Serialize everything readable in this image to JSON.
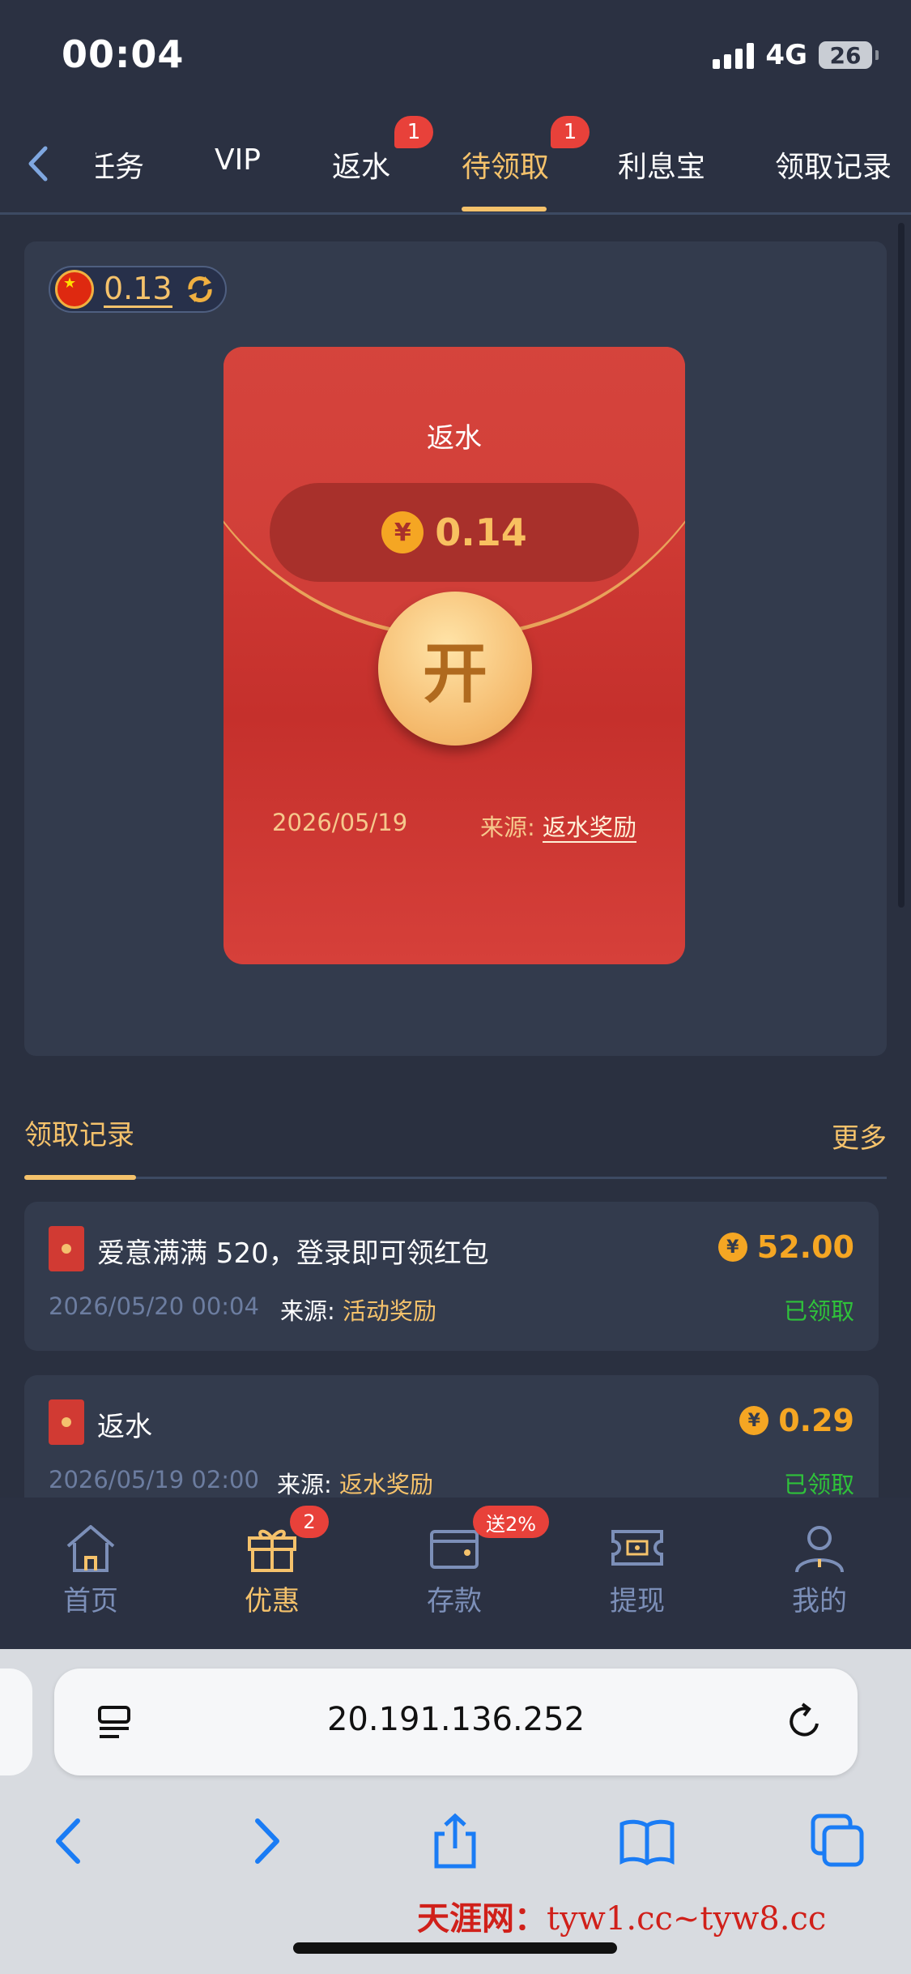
{
  "status": {
    "time": "00:04",
    "network": "4G",
    "battery": "26"
  },
  "tabs": [
    {
      "label": "任务",
      "badge": ""
    },
    {
      "label": "VIP",
      "badge": ""
    },
    {
      "label": "返水",
      "badge": "1"
    },
    {
      "label": "待领取",
      "badge": "1",
      "active": true
    },
    {
      "label": "利息宝",
      "badge": ""
    },
    {
      "label": "领取记录",
      "badge": ""
    }
  ],
  "balance": {
    "value": "0.13"
  },
  "envelope": {
    "title": "返水",
    "currency_symbol": "¥",
    "amount": "0.14",
    "open_label": "开",
    "date": "2026/05/19",
    "source_label": "来源:",
    "source_value": "返水奖励"
  },
  "records": {
    "title": "领取记录",
    "more_label": "更多",
    "items": [
      {
        "title": "爱意满满 520，登录即可领红包",
        "amount": "52.00",
        "time": "2026/05/20 00:04",
        "source_label": "来源:",
        "source_value": "活动奖励",
        "status": "已领取"
      },
      {
        "title": "返水",
        "amount": "0.29",
        "time": "2026/05/19 02:00",
        "source_label": "来源:",
        "source_value": "返水奖励",
        "status": "已领取"
      }
    ]
  },
  "bottom_nav": [
    {
      "label": "首页",
      "icon": "home-icon"
    },
    {
      "label": "优惠",
      "icon": "gift-icon",
      "badge": "2",
      "active": true
    },
    {
      "label": "存款",
      "icon": "wallet-icon",
      "badge": "送2%"
    },
    {
      "label": "提现",
      "icon": "withdraw-icon"
    },
    {
      "label": "我的",
      "icon": "profile-icon"
    }
  ],
  "browser": {
    "url": "20.191.136.252"
  },
  "watermark": {
    "brand": "天涯网：",
    "url": "tyw1.cc~tyw8.cc"
  },
  "colors": {
    "accent": "#f5c26b",
    "envelope_red": "#c5302c",
    "success": "#2fc23a",
    "badge_red": "#e8413a",
    "background": "#2a3040"
  }
}
